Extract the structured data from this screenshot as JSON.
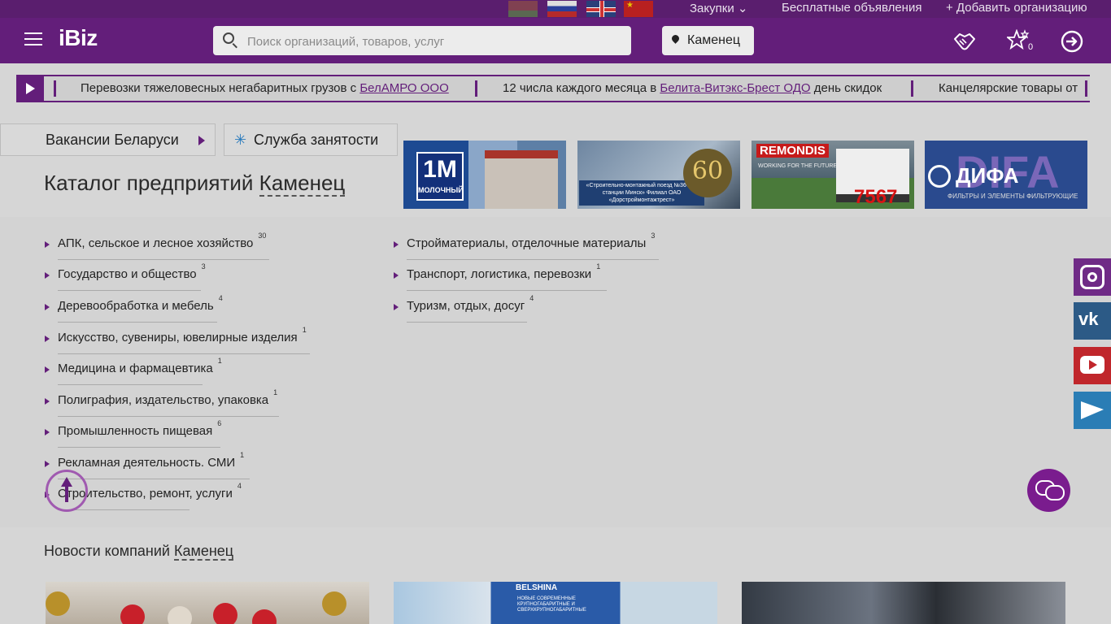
{
  "topbar": {
    "flags": [
      "by-flag",
      "ru-flag",
      "uk-flag",
      "cn-flag"
    ],
    "links": {
      "zakupki": "Закупки",
      "free_ads": "Бесплатные объявления",
      "add_org": "+ Добавить организацию"
    }
  },
  "header": {
    "logo": "iBiz",
    "search_placeholder": "Поиск организаций, товаров, услуг",
    "city": "Каменец",
    "favorites_count": "0"
  },
  "ticker": {
    "items": [
      {
        "prefix": "Перевозки тяжеловесных негабаритных грузов с ",
        "link": "БелАМРО ООО",
        "suffix": ""
      },
      {
        "prefix": "12 числа каждого месяца в ",
        "link": "Белита-Витэкс-Брест ОДО",
        "suffix": " день скидок"
      },
      {
        "prefix": "Канцелярские товары от ",
        "link": "",
        "suffix": ""
      }
    ]
  },
  "tabs": {
    "vacancies": "Вакансии Беларуси",
    "employment": "Служба занятости"
  },
  "catalog": {
    "title_prefix": "Каталог предприятий ",
    "city": "Каменец",
    "left": [
      {
        "name": "АПК, сельское и лесное хозяйство",
        "count": "30"
      },
      {
        "name": "Государство и общество",
        "count": "3"
      },
      {
        "name": "Деревообработка и мебель",
        "count": "4"
      },
      {
        "name": "Искусство, сувениры, ювелирные изделия",
        "count": "1"
      },
      {
        "name": "Медицина и фармацевтика",
        "count": "1"
      },
      {
        "name": "Полиграфия, издательство, упаковка",
        "count": "1"
      },
      {
        "name": "Промышленность пищевая",
        "count": "6"
      },
      {
        "name": "Рекламная деятельность. СМИ",
        "count": "1"
      },
      {
        "name": "Строительство, ремонт, услуги",
        "count": "4"
      }
    ],
    "right": [
      {
        "name": "Стройматериалы, отделочные материалы",
        "count": "3"
      },
      {
        "name": "Транспорт, логистика, перевозки",
        "count": "1"
      },
      {
        "name": "Туризм, отдых, досуг",
        "count": "4"
      }
    ]
  },
  "banners": {
    "b1": {
      "logo": "1M",
      "logo_sub": "МОЛОЧНЫЙ"
    },
    "b2": {
      "caption": "«Строительно-монтажный поезд №367 на станции Минск» Филиал ОАО «Дорстроймонтажтрест»",
      "anniversary": "60"
    },
    "b3": {
      "brand": "REMONDIS",
      "tagline": "WORKING FOR THE FUTURE",
      "phone": "7567"
    },
    "b4": {
      "bg_text": "DIFA",
      "name": "ДИФА",
      "sub": "ФИЛЬТРЫ И ЭЛЕМЕНТЫ ФИЛЬТРУЮЩИЕ"
    }
  },
  "news": {
    "title_prefix": "Новости компаний ",
    "city": "Каменец",
    "img2_brand": "BELSHINA",
    "img2_text": "НОВЫЕ СОВРЕМЕННЫЕ КРУПНОГАБАРИТНЫЕ И СВЕРХКРУПНОГАБАРИТНЫЕ"
  },
  "social": [
    "instagram-icon",
    "vk-icon",
    "youtube-icon",
    "telegram-icon"
  ],
  "colors": {
    "brand": "#631e7a",
    "accent": "#7a1c8e"
  }
}
